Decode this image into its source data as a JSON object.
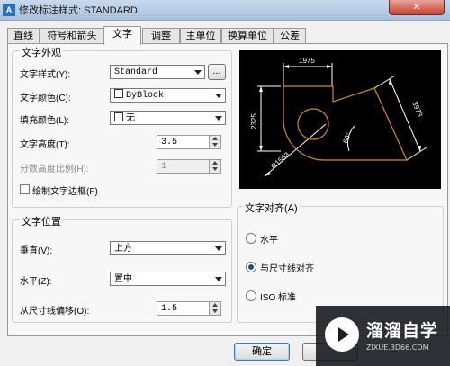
{
  "window": {
    "title": "修改标注样式: STANDARD",
    "close_glyph": "✕"
  },
  "tabs": [
    {
      "label": "直线",
      "active": false
    },
    {
      "label": "符号和箭头",
      "active": false
    },
    {
      "label": "文字",
      "active": true
    },
    {
      "label": "调整",
      "active": false
    },
    {
      "label": "主单位",
      "active": false
    },
    {
      "label": "换算单位",
      "active": false
    },
    {
      "label": "公差",
      "active": false
    }
  ],
  "appearance": {
    "title": "文字外观",
    "text_style": {
      "label": "文字样式(Y):",
      "value": "Standard",
      "browse": "..."
    },
    "text_color": {
      "label": "文字颜色(C):",
      "value": "ByBlock"
    },
    "fill_color": {
      "label": "填充颜色(L):",
      "value": "无"
    },
    "text_height": {
      "label": "文字高度(T):",
      "value": "3.5"
    },
    "fraction_scale": {
      "label": "分数高度比例(H):",
      "value": "1",
      "enabled": false
    },
    "draw_frame": {
      "label": "绘制文字边框(F)",
      "checked": false
    }
  },
  "placement": {
    "title": "文字位置",
    "vertical": {
      "label": "垂直(V):",
      "value": "上方"
    },
    "horizontal": {
      "label": "水平(Z):",
      "value": "置中"
    },
    "offset": {
      "label": "从尺寸线偏移(O):",
      "value": "1.5"
    }
  },
  "alignment": {
    "title": "文字对齐(A)",
    "options": [
      {
        "label": "水平",
        "selected": false
      },
      {
        "label": "与尺寸线对齐",
        "selected": true
      },
      {
        "label": "ISO 标准",
        "selected": false
      }
    ]
  },
  "preview": {
    "dim_top": "1975",
    "dim_left": "2325",
    "dim_right": "3973",
    "dim_angle": "60°",
    "dim_radius": "R1563",
    "colors": {
      "lines": "#ffffff",
      "geometry": "#d28b1e",
      "background": "#000000"
    }
  },
  "buttons": {
    "ok": "确定"
  },
  "watermark": {
    "name": "溜溜自学",
    "url": "ZIXUE.3D66.COM"
  }
}
